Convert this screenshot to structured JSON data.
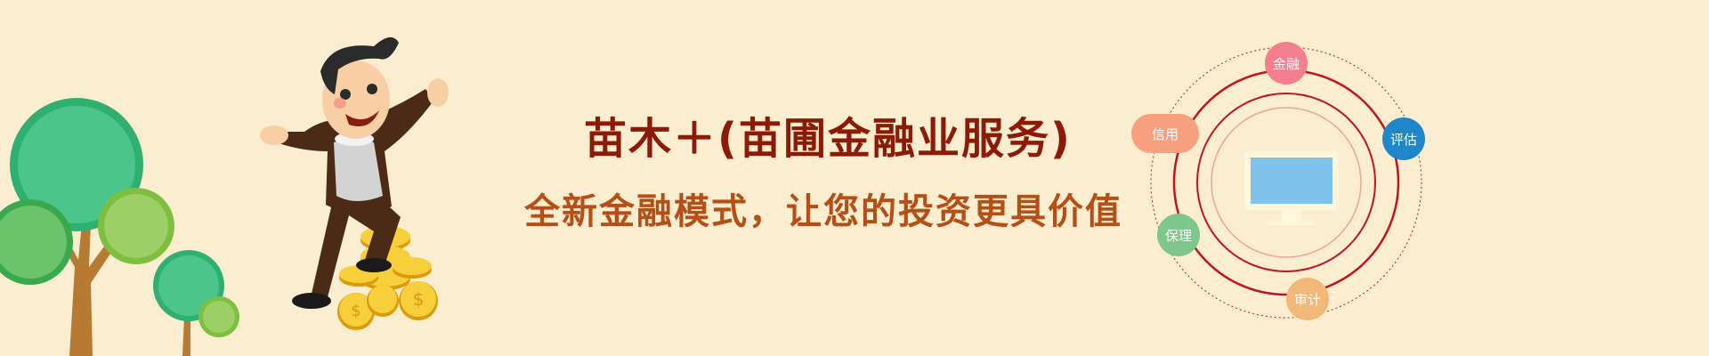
{
  "banner": {
    "headline": "苗木＋(苗圃金融业服务)",
    "subline": "全新金融模式，让您的投资更具价值"
  },
  "services": {
    "items": [
      {
        "key": "finance",
        "label": "金融",
        "color": "#f37e8d"
      },
      {
        "key": "eval",
        "label": "评估",
        "color": "#1f87c8"
      },
      {
        "key": "credit",
        "label": "信用",
        "color": "#f7a07f"
      },
      {
        "key": "factor",
        "label": "保理",
        "color": "#7ec78a"
      },
      {
        "key": "audit",
        "label": "审计",
        "color": "#f2b877"
      }
    ]
  },
  "colors": {
    "background": "#fbedcf",
    "headline": "#8b1a06",
    "subline": "#b54f16",
    "ring": "#c0141c",
    "monitor_screen": "#7fc3ec"
  },
  "icons": {
    "trees": "tree-illustration",
    "character": "cartoon-businessman",
    "coins": "gold-coin-stack",
    "monitor": "computer-monitor-icon"
  }
}
